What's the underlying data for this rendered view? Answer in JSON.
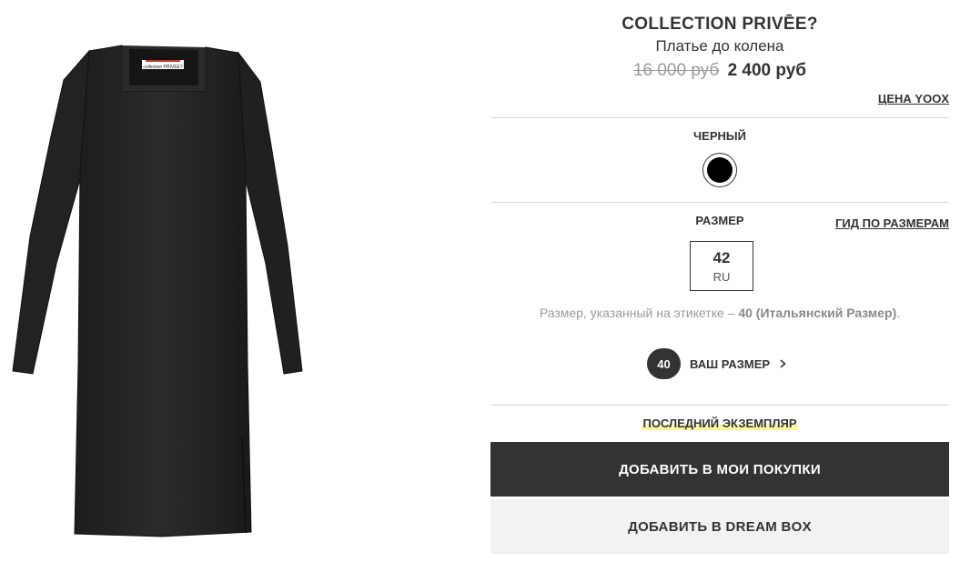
{
  "product": {
    "brand": "COLLECTION PRIVĒE?",
    "category": "Платье до колена",
    "label_on_garment": "collection PRIVĒE?"
  },
  "price": {
    "old": "16 000 руб",
    "current": "2 400 руб",
    "price_link": "ЦЕНА YOOX"
  },
  "color": {
    "label": "ЧЕРНЫЙ",
    "swatch_hex": "#000000"
  },
  "size": {
    "label": "РАЗМЕР",
    "guide_link": "ГИД ПО РАЗМЕРАМ",
    "value": "42",
    "unit": "RU",
    "note_prefix": "Размер, указанный на этикетке – ",
    "note_bold": "40 (Итальянский Размер)",
    "note_suffix": ".",
    "your_size_badge": "40",
    "your_size_label": "ВАШ РАЗМЕР"
  },
  "stock": {
    "label": "ПОСЛЕДНИЙ ЭКЗЕМПЛЯР",
    "highlight_hex": "#fff59a"
  },
  "actions": {
    "add_to_cart": "ДОБАВИТЬ В МОИ ПОКУПКИ",
    "add_to_dreambox": "ДОБАВИТЬ В DREAM BOX"
  },
  "colors": {
    "text": "#333333",
    "muted": "#9b9b9b",
    "divider": "#d9d9d9",
    "primary_button": "#333333",
    "secondary_button": "#f2f2f2"
  },
  "icons": {
    "your_size_arrow": "chevron-right-icon"
  }
}
